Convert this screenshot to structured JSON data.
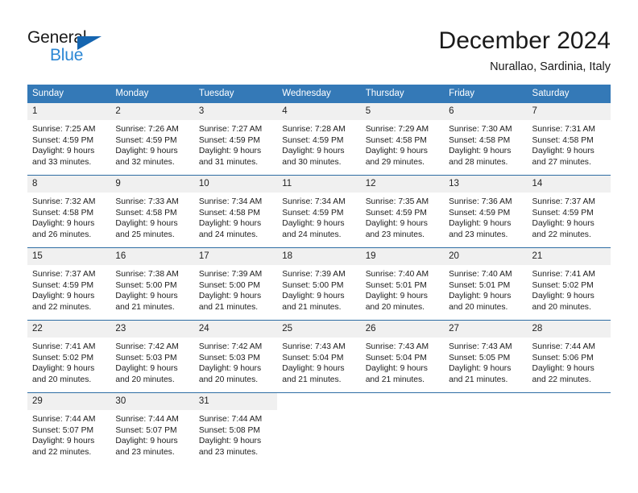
{
  "brand": {
    "name_part1": "General",
    "name_part2": "Blue",
    "triangle_icon": "triangle-icon",
    "accent_dark": "#1565b0",
    "accent_light": "#2b87d4"
  },
  "header": {
    "month_title": "December 2024",
    "location": "Nurallao, Sardinia, Italy"
  },
  "calendar": {
    "header_bg": "#3479b7",
    "row_divider": "#2e6da4",
    "daynum_bg": "#f0f0f0",
    "weekdays": [
      "Sunday",
      "Monday",
      "Tuesday",
      "Wednesday",
      "Thursday",
      "Friday",
      "Saturday"
    ],
    "weeks": [
      [
        {
          "day": "1",
          "sunrise": "Sunrise: 7:25 AM",
          "sunset": "Sunset: 4:59 PM",
          "daylight_line1": "Daylight: 9 hours",
          "daylight_line2": "and 33 minutes."
        },
        {
          "day": "2",
          "sunrise": "Sunrise: 7:26 AM",
          "sunset": "Sunset: 4:59 PM",
          "daylight_line1": "Daylight: 9 hours",
          "daylight_line2": "and 32 minutes."
        },
        {
          "day": "3",
          "sunrise": "Sunrise: 7:27 AM",
          "sunset": "Sunset: 4:59 PM",
          "daylight_line1": "Daylight: 9 hours",
          "daylight_line2": "and 31 minutes."
        },
        {
          "day": "4",
          "sunrise": "Sunrise: 7:28 AM",
          "sunset": "Sunset: 4:59 PM",
          "daylight_line1": "Daylight: 9 hours",
          "daylight_line2": "and 30 minutes."
        },
        {
          "day": "5",
          "sunrise": "Sunrise: 7:29 AM",
          "sunset": "Sunset: 4:58 PM",
          "daylight_line1": "Daylight: 9 hours",
          "daylight_line2": "and 29 minutes."
        },
        {
          "day": "6",
          "sunrise": "Sunrise: 7:30 AM",
          "sunset": "Sunset: 4:58 PM",
          "daylight_line1": "Daylight: 9 hours",
          "daylight_line2": "and 28 minutes."
        },
        {
          "day": "7",
          "sunrise": "Sunrise: 7:31 AM",
          "sunset": "Sunset: 4:58 PM",
          "daylight_line1": "Daylight: 9 hours",
          "daylight_line2": "and 27 minutes."
        }
      ],
      [
        {
          "day": "8",
          "sunrise": "Sunrise: 7:32 AM",
          "sunset": "Sunset: 4:58 PM",
          "daylight_line1": "Daylight: 9 hours",
          "daylight_line2": "and 26 minutes."
        },
        {
          "day": "9",
          "sunrise": "Sunrise: 7:33 AM",
          "sunset": "Sunset: 4:58 PM",
          "daylight_line1": "Daylight: 9 hours",
          "daylight_line2": "and 25 minutes."
        },
        {
          "day": "10",
          "sunrise": "Sunrise: 7:34 AM",
          "sunset": "Sunset: 4:58 PM",
          "daylight_line1": "Daylight: 9 hours",
          "daylight_line2": "and 24 minutes."
        },
        {
          "day": "11",
          "sunrise": "Sunrise: 7:34 AM",
          "sunset": "Sunset: 4:59 PM",
          "daylight_line1": "Daylight: 9 hours",
          "daylight_line2": "and 24 minutes."
        },
        {
          "day": "12",
          "sunrise": "Sunrise: 7:35 AM",
          "sunset": "Sunset: 4:59 PM",
          "daylight_line1": "Daylight: 9 hours",
          "daylight_line2": "and 23 minutes."
        },
        {
          "day": "13",
          "sunrise": "Sunrise: 7:36 AM",
          "sunset": "Sunset: 4:59 PM",
          "daylight_line1": "Daylight: 9 hours",
          "daylight_line2": "and 23 minutes."
        },
        {
          "day": "14",
          "sunrise": "Sunrise: 7:37 AM",
          "sunset": "Sunset: 4:59 PM",
          "daylight_line1": "Daylight: 9 hours",
          "daylight_line2": "and 22 minutes."
        }
      ],
      [
        {
          "day": "15",
          "sunrise": "Sunrise: 7:37 AM",
          "sunset": "Sunset: 4:59 PM",
          "daylight_line1": "Daylight: 9 hours",
          "daylight_line2": "and 22 minutes."
        },
        {
          "day": "16",
          "sunrise": "Sunrise: 7:38 AM",
          "sunset": "Sunset: 5:00 PM",
          "daylight_line1": "Daylight: 9 hours",
          "daylight_line2": "and 21 minutes."
        },
        {
          "day": "17",
          "sunrise": "Sunrise: 7:39 AM",
          "sunset": "Sunset: 5:00 PM",
          "daylight_line1": "Daylight: 9 hours",
          "daylight_line2": "and 21 minutes."
        },
        {
          "day": "18",
          "sunrise": "Sunrise: 7:39 AM",
          "sunset": "Sunset: 5:00 PM",
          "daylight_line1": "Daylight: 9 hours",
          "daylight_line2": "and 21 minutes."
        },
        {
          "day": "19",
          "sunrise": "Sunrise: 7:40 AM",
          "sunset": "Sunset: 5:01 PM",
          "daylight_line1": "Daylight: 9 hours",
          "daylight_line2": "and 20 minutes."
        },
        {
          "day": "20",
          "sunrise": "Sunrise: 7:40 AM",
          "sunset": "Sunset: 5:01 PM",
          "daylight_line1": "Daylight: 9 hours",
          "daylight_line2": "and 20 minutes."
        },
        {
          "day": "21",
          "sunrise": "Sunrise: 7:41 AM",
          "sunset": "Sunset: 5:02 PM",
          "daylight_line1": "Daylight: 9 hours",
          "daylight_line2": "and 20 minutes."
        }
      ],
      [
        {
          "day": "22",
          "sunrise": "Sunrise: 7:41 AM",
          "sunset": "Sunset: 5:02 PM",
          "daylight_line1": "Daylight: 9 hours",
          "daylight_line2": "and 20 minutes."
        },
        {
          "day": "23",
          "sunrise": "Sunrise: 7:42 AM",
          "sunset": "Sunset: 5:03 PM",
          "daylight_line1": "Daylight: 9 hours",
          "daylight_line2": "and 20 minutes."
        },
        {
          "day": "24",
          "sunrise": "Sunrise: 7:42 AM",
          "sunset": "Sunset: 5:03 PM",
          "daylight_line1": "Daylight: 9 hours",
          "daylight_line2": "and 20 minutes."
        },
        {
          "day": "25",
          "sunrise": "Sunrise: 7:43 AM",
          "sunset": "Sunset: 5:04 PM",
          "daylight_line1": "Daylight: 9 hours",
          "daylight_line2": "and 21 minutes."
        },
        {
          "day": "26",
          "sunrise": "Sunrise: 7:43 AM",
          "sunset": "Sunset: 5:04 PM",
          "daylight_line1": "Daylight: 9 hours",
          "daylight_line2": "and 21 minutes."
        },
        {
          "day": "27",
          "sunrise": "Sunrise: 7:43 AM",
          "sunset": "Sunset: 5:05 PM",
          "daylight_line1": "Daylight: 9 hours",
          "daylight_line2": "and 21 minutes."
        },
        {
          "day": "28",
          "sunrise": "Sunrise: 7:44 AM",
          "sunset": "Sunset: 5:06 PM",
          "daylight_line1": "Daylight: 9 hours",
          "daylight_line2": "and 22 minutes."
        }
      ],
      [
        {
          "day": "29",
          "sunrise": "Sunrise: 7:44 AM",
          "sunset": "Sunset: 5:07 PM",
          "daylight_line1": "Daylight: 9 hours",
          "daylight_line2": "and 22 minutes."
        },
        {
          "day": "30",
          "sunrise": "Sunrise: 7:44 AM",
          "sunset": "Sunset: 5:07 PM",
          "daylight_line1": "Daylight: 9 hours",
          "daylight_line2": "and 23 minutes."
        },
        {
          "day": "31",
          "sunrise": "Sunrise: 7:44 AM",
          "sunset": "Sunset: 5:08 PM",
          "daylight_line1": "Daylight: 9 hours",
          "daylight_line2": "and 23 minutes."
        },
        {
          "day": "",
          "sunrise": "",
          "sunset": "",
          "daylight_line1": "",
          "daylight_line2": ""
        },
        {
          "day": "",
          "sunrise": "",
          "sunset": "",
          "daylight_line1": "",
          "daylight_line2": ""
        },
        {
          "day": "",
          "sunrise": "",
          "sunset": "",
          "daylight_line1": "",
          "daylight_line2": ""
        },
        {
          "day": "",
          "sunrise": "",
          "sunset": "",
          "daylight_line1": "",
          "daylight_line2": ""
        }
      ]
    ]
  }
}
